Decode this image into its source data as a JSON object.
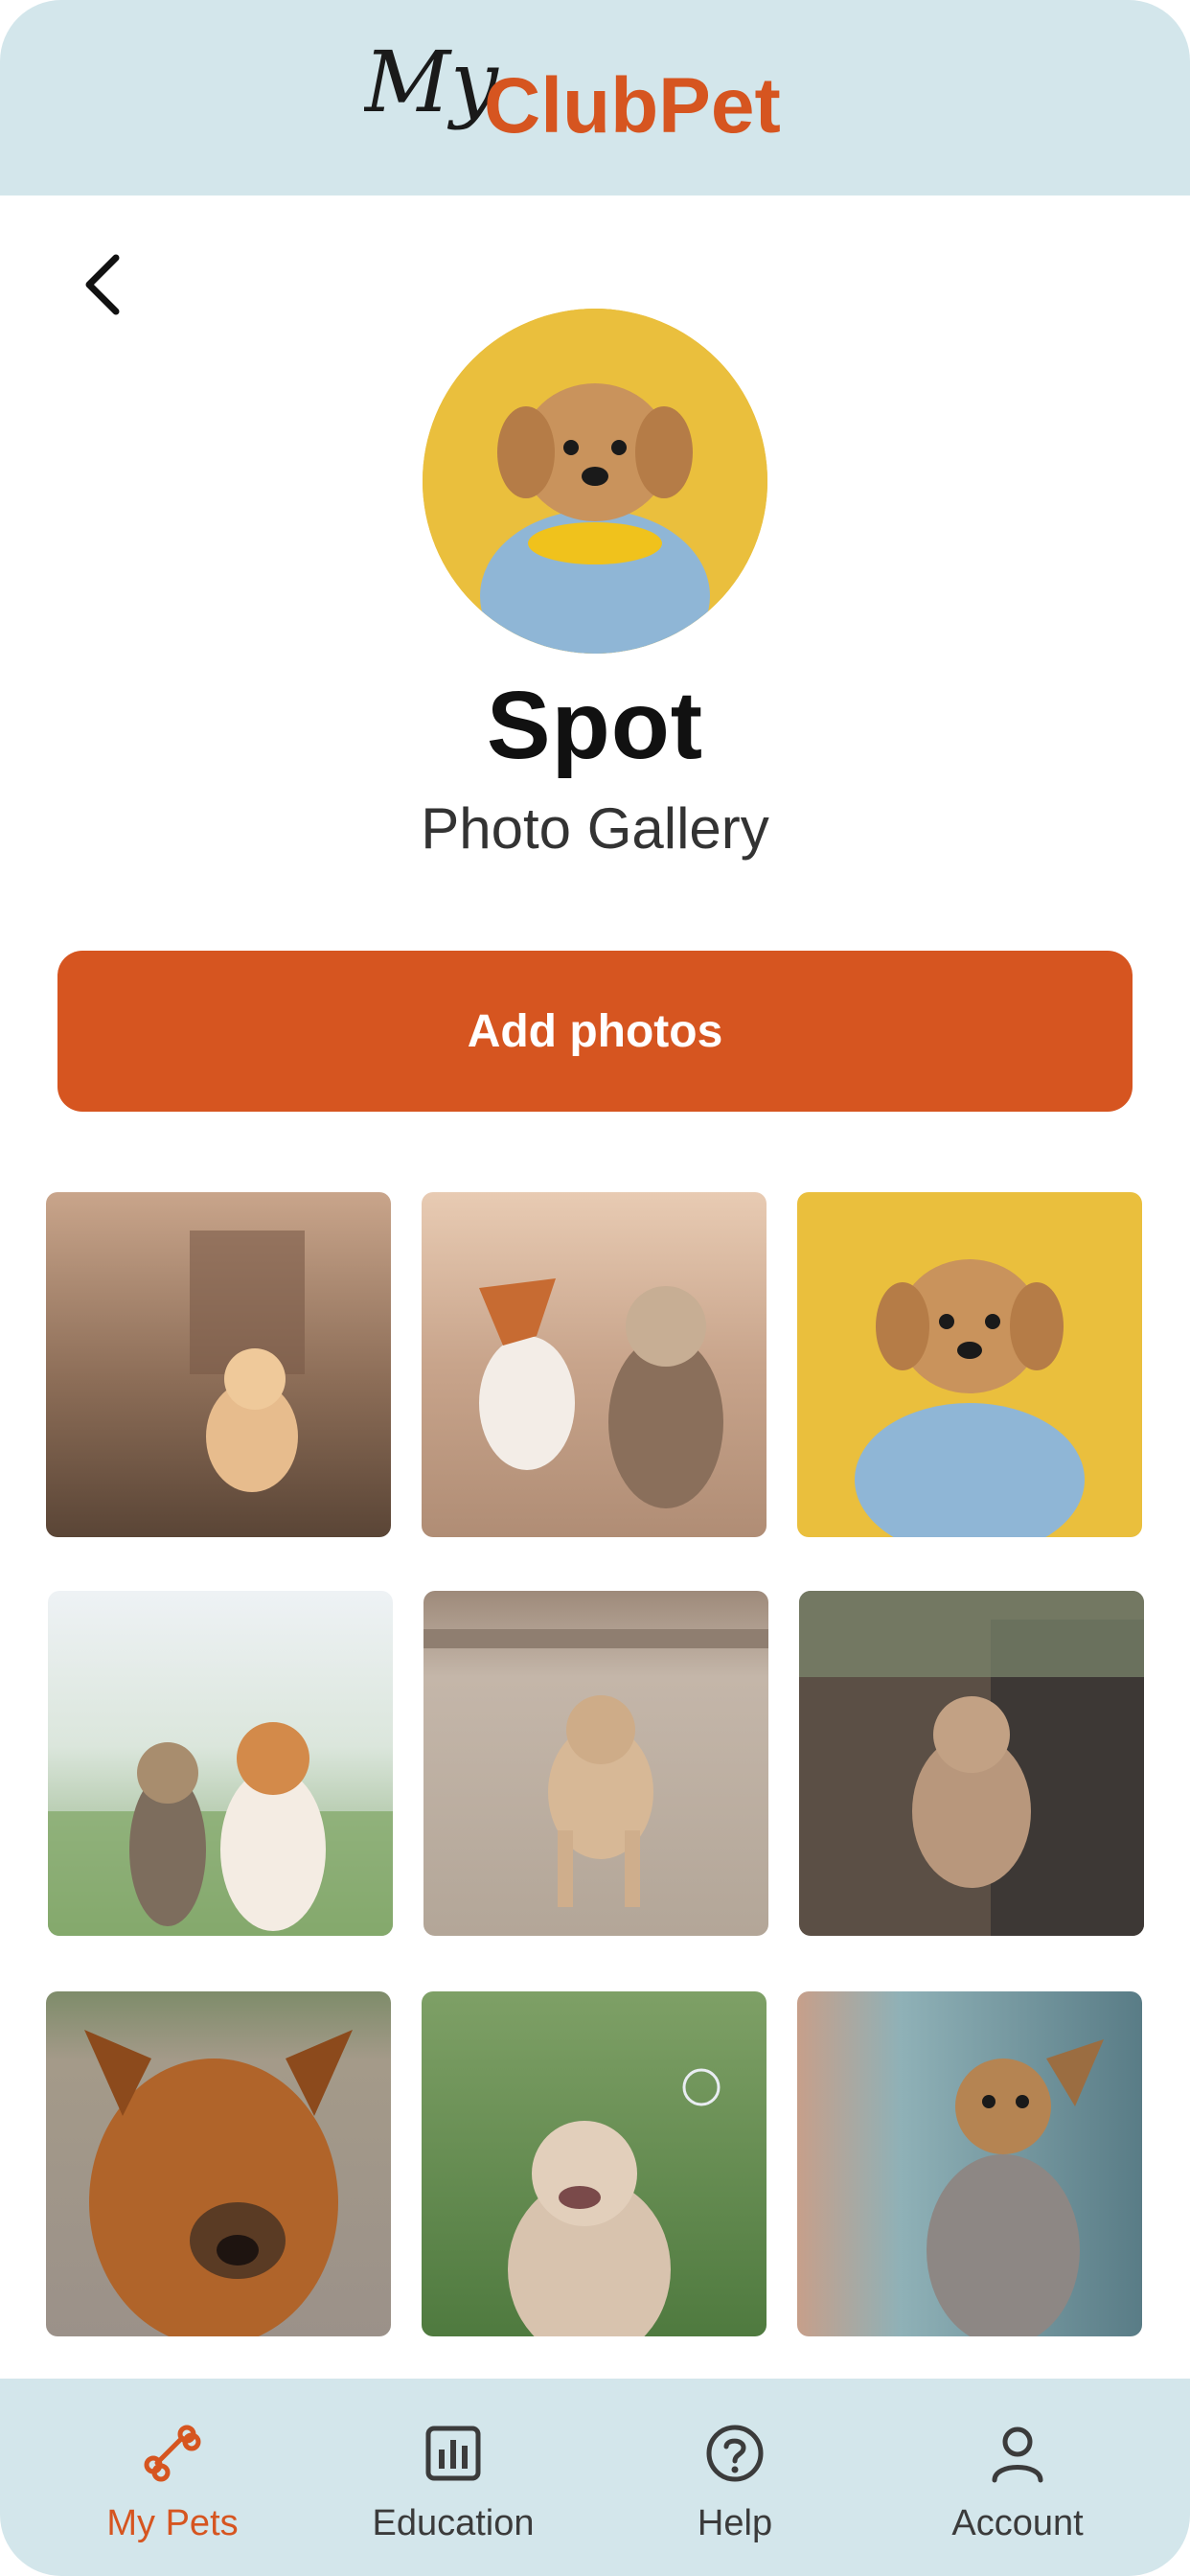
{
  "app": {
    "logo_script": "My",
    "logo_brand": "ClubPet",
    "brand_color": "#d65520",
    "header_color": "#d3e6eb"
  },
  "profile": {
    "name": "Spot",
    "subtitle": "Photo Gallery",
    "avatar_icon": "dog-photo"
  },
  "actions": {
    "add_photos_label": "Add photos"
  },
  "gallery": {
    "photos": [
      {
        "name": "photo-golden-puppy-running"
      },
      {
        "name": "photo-corgi-and-yorkie"
      },
      {
        "name": "photo-spot-yellow-background"
      },
      {
        "name": "photo-yorkie-and-corgi-grass"
      },
      {
        "name": "photo-doodle-on-road"
      },
      {
        "name": "photo-poodle-by-stone-wall"
      },
      {
        "name": "photo-airedale-closeup"
      },
      {
        "name": "photo-doodle-with-bubble"
      },
      {
        "name": "photo-yorkie-profile"
      }
    ]
  },
  "nav": {
    "items": [
      {
        "label": "My Pets",
        "icon": "bone-icon",
        "active": true
      },
      {
        "label": "Education",
        "icon": "bar-chart-icon",
        "active": false
      },
      {
        "label": "Help",
        "icon": "question-icon",
        "active": false
      },
      {
        "label": "Account",
        "icon": "person-icon",
        "active": false
      }
    ]
  }
}
